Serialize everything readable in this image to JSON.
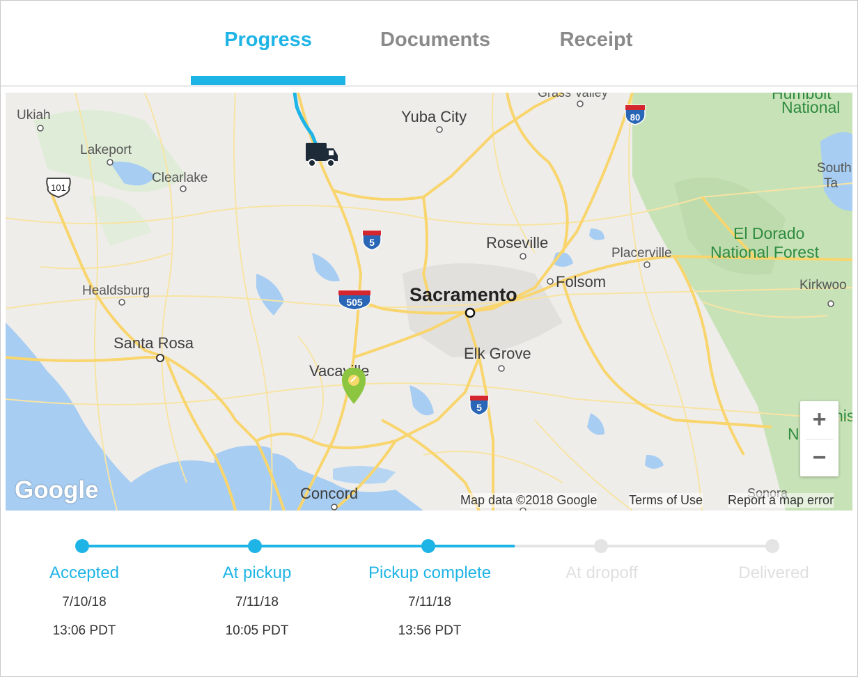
{
  "tabs": [
    {
      "label": "Progress",
      "active": true
    },
    {
      "label": "Documents",
      "active": false
    },
    {
      "label": "Receipt",
      "active": false
    }
  ],
  "map": {
    "labels": {
      "grass_valley": "Grass Valley",
      "humboldt": "Humbolt",
      "national_top": "National",
      "ukiah": "Ukiah",
      "yuba_city": "Yuba City",
      "lakeport": "Lakeport",
      "clearlake": "Clearlake",
      "south_tahoe_1": "South",
      "south_tahoe_2": "Ta",
      "roseville": "Roseville",
      "placerville": "Placerville",
      "el_dorado_1": "El Dorado",
      "el_dorado_2": "National Forest",
      "healdsburg": "Healdsburg",
      "sacramento": "Sacramento",
      "folsom": "Folsom",
      "kirkwood": "Kirkwoo",
      "santa_rosa": "Santa Rosa",
      "elk_grove": "Elk Grove",
      "vacaville": "Vacaville",
      "concord": "Concord",
      "sonora": "Sonora",
      "stanislaus_1": "nis",
      "stanislaus_2": "N"
    },
    "shields": {
      "us101": "101",
      "i80": "80",
      "i5_north": "5",
      "i505": "505",
      "i5_south": "5"
    },
    "zoom_in": "+",
    "zoom_out": "−",
    "google": "Google",
    "map_data": "Map data ©2018 Google",
    "terms": "Terms of Use",
    "report": "Report a map error"
  },
  "steps": [
    {
      "label": "Accepted",
      "date": "7/10/18",
      "time": "13:06 PDT",
      "done": true
    },
    {
      "label": "At pickup",
      "date": "7/11/18",
      "time": "10:05 PDT",
      "done": true
    },
    {
      "label": "Pickup complete",
      "date": "7/11/18",
      "time": "13:56 PDT",
      "done": true
    },
    {
      "label": "At dropoff",
      "date": "",
      "time": "",
      "done": false
    },
    {
      "label": "Delivered",
      "date": "",
      "time": "",
      "done": false
    }
  ],
  "colors": {
    "accent": "#1fb4e6",
    "inactive_tab": "#8a8a8a",
    "pending": "#e4e4e4",
    "pending_text": "#e0e0e0",
    "pin": "#8cc540",
    "road": "#f9d56e",
    "water": "#a7cdf2",
    "forest": "#c8e2b8"
  },
  "icons": {
    "vehicle": "truck-icon",
    "pickup_marker": "map-pin-icon"
  }
}
